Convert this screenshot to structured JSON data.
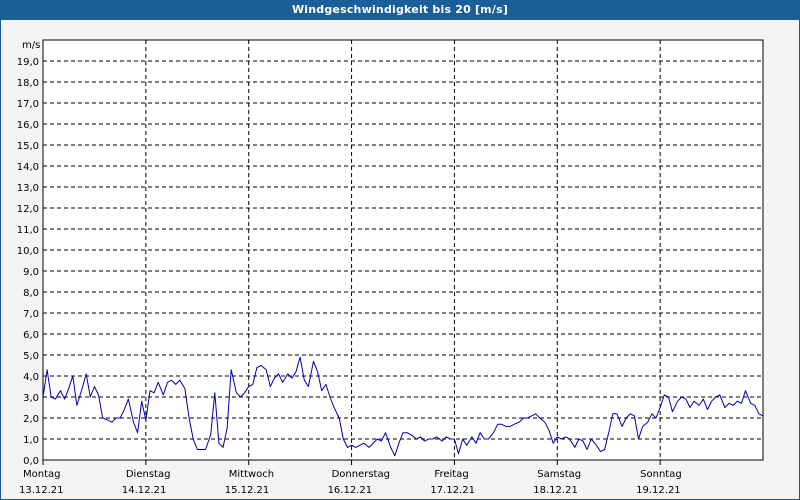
{
  "window": {
    "title": "Windgeschwindigkeit bis 20 [m/s]"
  },
  "chart_data": {
    "type": "line",
    "title": "Windgeschwindigkeit bis 20 [m/s]",
    "ylabel": "m/s",
    "xlabel": "",
    "ylim": [
      0,
      20
    ],
    "y_ticks": [
      "0,0",
      "1,0",
      "2,0",
      "3,0",
      "4,0",
      "5,0",
      "6,0",
      "7,0",
      "8,0",
      "9,0",
      "10,0",
      "11,0",
      "12,0",
      "13,0",
      "14,0",
      "15,0",
      "16,0",
      "17,0",
      "18,0",
      "19,0"
    ],
    "x_range_days": [
      0,
      7
    ],
    "x_ticks": [
      {
        "day": "Montag",
        "date": "13.12.21"
      },
      {
        "day": "Dienstag",
        "date": "14.12.21"
      },
      {
        "day": "Mittwoch",
        "date": "15.12.21"
      },
      {
        "day": "Donnerstag",
        "date": "16.12.21"
      },
      {
        "day": "Freitag",
        "date": "17.12.21"
      },
      {
        "day": "Samstag",
        "date": "18.12.21"
      },
      {
        "day": "Sonntag",
        "date": "19.12.21"
      }
    ],
    "grid": true,
    "line_color": "#0000aa",
    "series": [
      {
        "x": [
          0.0,
          0.04,
          0.08,
          0.12,
          0.17,
          0.21,
          0.25,
          0.29,
          0.33,
          0.38,
          0.42,
          0.46,
          0.5,
          0.54,
          0.58,
          0.63,
          0.67,
          0.71,
          0.75,
          0.79,
          0.83,
          0.88,
          0.92,
          0.96,
          1.0,
          1.04,
          1.08,
          1.12,
          1.17,
          1.21,
          1.25,
          1.29,
          1.33,
          1.38,
          1.42,
          1.46,
          1.5,
          1.54,
          1.58,
          1.63,
          1.67,
          1.71,
          1.75,
          1.79,
          1.83,
          1.88,
          1.92,
          1.96,
          2.0,
          2.04,
          2.08,
          2.12,
          2.17,
          2.21,
          2.25,
          2.29,
          2.33,
          2.38,
          2.42,
          2.46,
          2.5,
          2.54,
          2.58,
          2.63,
          2.67,
          2.71,
          2.75,
          2.79,
          2.83,
          2.88,
          2.92,
          2.96,
          3.0,
          3.04,
          3.08,
          3.12,
          3.17,
          3.21,
          3.25,
          3.29,
          3.33,
          3.38,
          3.42,
          3.46,
          3.5,
          3.54,
          3.58,
          3.63,
          3.67,
          3.71,
          3.75,
          3.79,
          3.83,
          3.88,
          3.92,
          3.96,
          4.0,
          4.04,
          4.08,
          4.12,
          4.17,
          4.21,
          4.25,
          4.29,
          4.33,
          4.38,
          4.42,
          4.46,
          4.5,
          4.54,
          4.58,
          4.63,
          4.67,
          4.71,
          4.75,
          4.79,
          4.83,
          4.88,
          4.92,
          4.96,
          5.0,
          5.04,
          5.08,
          5.12,
          5.17,
          5.21,
          5.25,
          5.29,
          5.33,
          5.38,
          5.42,
          5.46,
          5.5,
          5.54,
          5.58,
          5.63,
          5.67,
          5.71,
          5.75,
          5.79,
          5.83,
          5.88,
          5.92,
          5.96,
          6.0,
          6.04,
          6.08,
          6.12,
          6.17,
          6.21,
          6.25,
          6.29,
          6.33,
          6.38,
          6.42,
          6.46,
          6.5,
          6.54,
          6.58,
          6.63,
          6.67,
          6.71,
          6.75,
          6.79,
          6.83,
          6.88,
          6.92,
          6.96,
          7.0
        ],
        "values": [
          3.0,
          4.3,
          3.0,
          2.9,
          3.3,
          2.9,
          3.4,
          4.0,
          2.6,
          3.4,
          4.1,
          3.0,
          3.5,
          3.1,
          2.0,
          1.9,
          1.8,
          2.0,
          2.0,
          2.4,
          2.9,
          1.8,
          1.3,
          2.8,
          1.9,
          3.3,
          3.2,
          3.7,
          3.1,
          3.7,
          3.8,
          3.6,
          3.8,
          3.4,
          2.0,
          1.0,
          0.5,
          0.5,
          0.5,
          1.2,
          3.2,
          0.8,
          0.6,
          1.5,
          4.3,
          3.2,
          3.0,
          3.2,
          3.5,
          3.6,
          4.4,
          4.5,
          4.3,
          3.5,
          3.9,
          4.1,
          3.7,
          4.1,
          3.9,
          4.2,
          4.9,
          3.8,
          3.5,
          4.7,
          4.2,
          3.3,
          3.6,
          3.0,
          2.5,
          2.0,
          1.0,
          0.6,
          0.7,
          0.6,
          0.7,
          0.8,
          0.6,
          0.8,
          1.0,
          0.9,
          1.3,
          0.6,
          0.2,
          0.8,
          1.3,
          1.3,
          1.2,
          1.0,
          1.1,
          0.9,
          1.0,
          1.0,
          1.1,
          0.9,
          1.1,
          1.0,
          1.0,
          0.3,
          1.0,
          0.7,
          1.1,
          0.8,
          1.3,
          1.0,
          1.0,
          1.3,
          1.7,
          1.7,
          1.6,
          1.6,
          1.7,
          1.8,
          2.0,
          2.0,
          2.1,
          2.2,
          2.0,
          1.8,
          1.4,
          0.8,
          1.1,
          1.0,
          1.1,
          1.0,
          0.6,
          1.0,
          0.9,
          0.5,
          1.0,
          0.7,
          0.4,
          0.5,
          1.3,
          2.2,
          2.2,
          1.6,
          2.0,
          2.2,
          2.1,
          1.0,
          1.6,
          1.8,
          2.2,
          2.0,
          2.5,
          3.1,
          3.0,
          2.3,
          2.8,
          3.0,
          2.9,
          2.5,
          2.8,
          2.6,
          2.9,
          2.4,
          2.8,
          3.0,
          3.1,
          2.5,
          2.7,
          2.6,
          2.8,
          2.7,
          3.3,
          2.7,
          2.6,
          2.2,
          2.1
        ]
      }
    ]
  }
}
